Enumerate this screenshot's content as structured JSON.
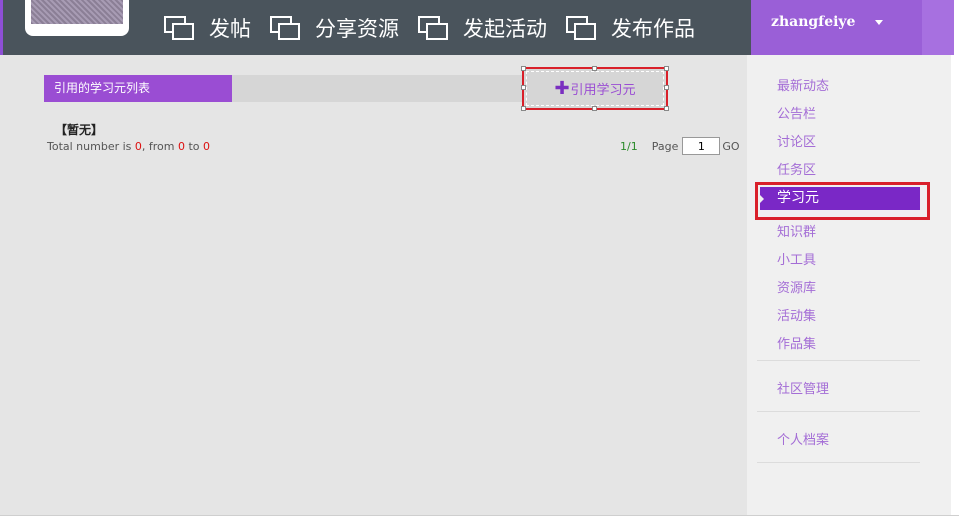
{
  "header": {
    "nav": [
      {
        "label": "发帖"
      },
      {
        "label": "分享资源"
      },
      {
        "label": "发起活动"
      },
      {
        "label": "发布作品"
      }
    ],
    "username": "zhangfeiye"
  },
  "main": {
    "list_title": "引用的学习元列表",
    "quote_button": "引用学习元",
    "empty_text": "【暂无】",
    "total_prefix": "Total number is ",
    "total_count": "0",
    "from_label": ", from ",
    "from_value": "0",
    "to_label": " to ",
    "to_value": "0",
    "pager": {
      "current": "1/1",
      "page_label": "Page",
      "page_value": "1",
      "go_label": "GO"
    }
  },
  "sidebar": {
    "items": [
      {
        "label": "最新动态"
      },
      {
        "label": "公告栏"
      },
      {
        "label": "讨论区"
      },
      {
        "label": "任务区"
      },
      {
        "label": "学习元"
      },
      {
        "label": "知识群"
      },
      {
        "label": "小工具"
      },
      {
        "label": "资源库"
      },
      {
        "label": "活动集"
      },
      {
        "label": "作品集"
      },
      {
        "label": "社区管理"
      },
      {
        "label": "个人档案"
      }
    ],
    "active_index": 4
  },
  "colors": {
    "header_bg": "#4a545c",
    "accent_purple": "#9a4dd3",
    "highlight_red": "#d9202a"
  }
}
